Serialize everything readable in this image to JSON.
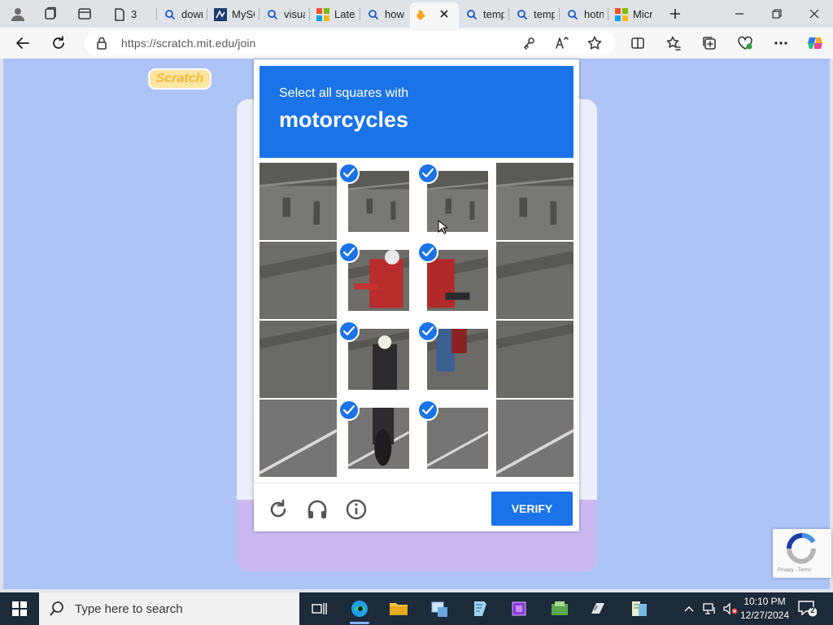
{
  "browser": {
    "tabs": [
      {
        "title": "3",
        "icon": "page-icon"
      },
      {
        "title": "dowr",
        "icon": "search-icon"
      },
      {
        "title": "MySC",
        "icon": "mysql-icon"
      },
      {
        "title": "visua",
        "icon": "search-icon"
      },
      {
        "title": "Lates",
        "icon": "microsoft-icon"
      },
      {
        "title": "how",
        "icon": "search-icon"
      },
      {
        "title": "",
        "icon": "scratch-icon",
        "active": true
      },
      {
        "title": "temp",
        "icon": "search-icon"
      },
      {
        "title": "temp",
        "icon": "search-icon"
      },
      {
        "title": "hotn",
        "icon": "search-icon"
      },
      {
        "title": "Micro",
        "icon": "microsoft-icon"
      }
    ],
    "url": "https://scratch.mit.edu/join"
  },
  "page": {
    "logo_text": "Scratch"
  },
  "captcha": {
    "instruction": "Select all squares with",
    "target": "motorcycles",
    "tiles_selected": [
      false,
      true,
      true,
      false,
      false,
      true,
      true,
      false,
      false,
      true,
      true,
      false,
      false,
      true,
      true,
      false
    ],
    "verify_label": "VERIFY",
    "badge_text": "Privacy - Terms",
    "accent": "#1a73e8"
  },
  "taskbar": {
    "search_placeholder": "Type here to search",
    "time": "10:10 PM",
    "date": "12/27/2024",
    "notification_count": "2"
  }
}
